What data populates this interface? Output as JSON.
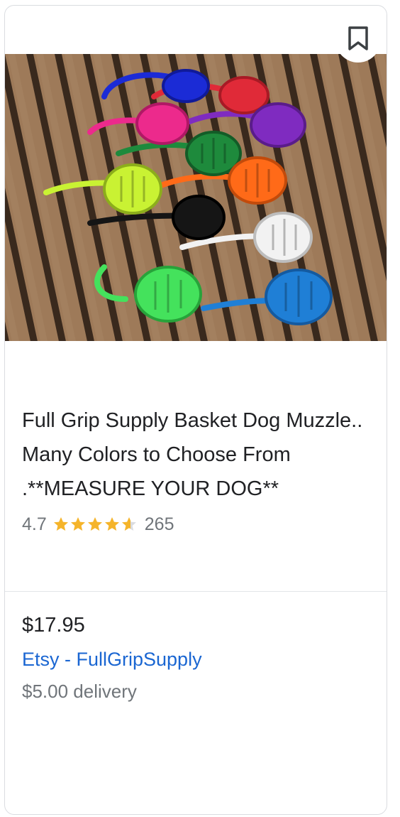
{
  "product": {
    "image_alt": "Basket dog muzzles in many colors on wooden deck",
    "title": "Full Grip Supply Basket Dog Muzzle.. Many Colors to Choose From .**MEASURE YOUR DOG**",
    "rating": "4.7",
    "stars": 4.7,
    "review_count": "265",
    "price": "$17.95",
    "seller": "Etsy - FullGripSupply",
    "delivery": "$5.00 delivery"
  },
  "icons": {
    "save": "bookmark-icon",
    "star": "star-icon"
  },
  "colors": {
    "star": "#f5b42a",
    "star_empty": "#dadce0",
    "seller_link": "#1a66d2",
    "muted_text": "#70757a",
    "title_text": "#202124"
  }
}
